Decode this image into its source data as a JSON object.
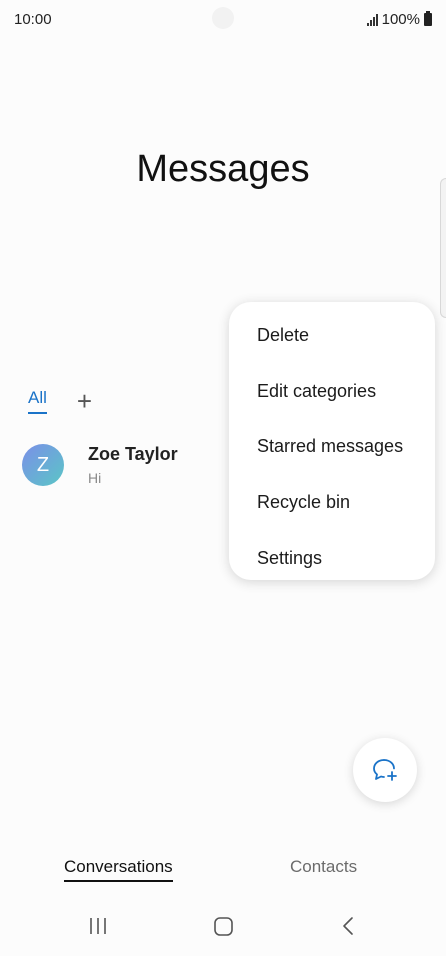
{
  "status_bar": {
    "time": "10:00",
    "battery": "100%"
  },
  "page": {
    "title": "Messages"
  },
  "tabs": {
    "active": "All",
    "add_icon": "plus-icon"
  },
  "conversations": [
    {
      "avatar_letter": "Z",
      "name": "Zoe Taylor",
      "preview": "Hi"
    }
  ],
  "menu": {
    "items": [
      "Delete",
      "Edit categories",
      "Starred messages",
      "Recycle bin",
      "Settings"
    ]
  },
  "fab": {
    "icon": "new-message-icon",
    "color": "#1a73c8"
  },
  "bottom_nav": {
    "conversations": "Conversations",
    "contacts": "Contacts"
  },
  "system_nav": {
    "recent": "recent-apps-icon",
    "home": "home-icon",
    "back": "back-icon"
  },
  "colors": {
    "accent": "#1a73c8",
    "avatar_start": "#7b8fe8",
    "avatar_end": "#5ac6c6"
  }
}
